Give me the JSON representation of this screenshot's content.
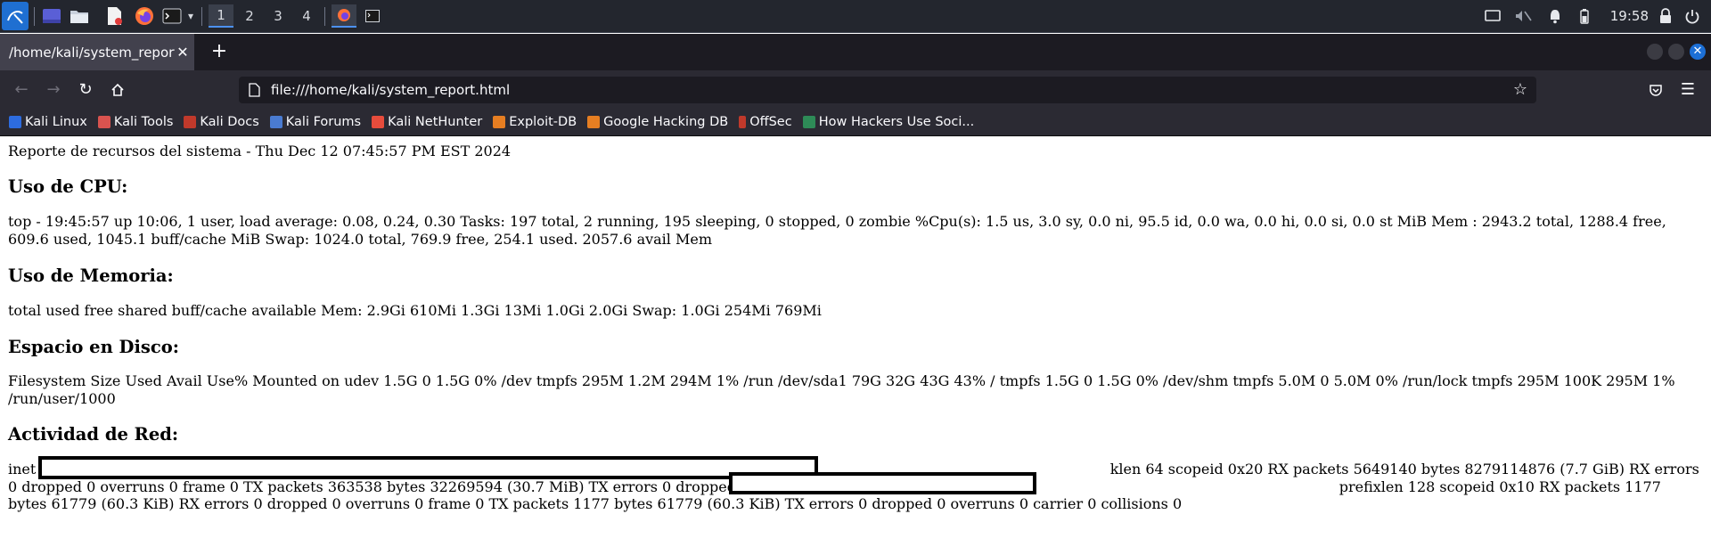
{
  "taskbar": {
    "workspaces": [
      "1",
      "2",
      "3",
      "4"
    ],
    "clock": "19:58"
  },
  "browser": {
    "tab_title": "/home/kali/system_report.html",
    "url": "file:///home/kali/system_report.html",
    "bookmarks": [
      {
        "label": "Kali Linux",
        "color": "#2d6cdf"
      },
      {
        "label": "Kali Tools",
        "color": "#d9534f"
      },
      {
        "label": "Kali Docs",
        "color": "#c0392b"
      },
      {
        "label": "Kali Forums",
        "color": "#4a7bd1"
      },
      {
        "label": "Kali NetHunter",
        "color": "#e74c3c"
      },
      {
        "label": "Exploit-DB",
        "color": "#e67e22"
      },
      {
        "label": "Google Hacking DB",
        "color": "#e67e22"
      },
      {
        "label": "OffSec",
        "color": "#c0392b"
      },
      {
        "label": "How Hackers Use Soci...",
        "color": "#2e8b57"
      }
    ]
  },
  "report": {
    "header": "Reporte de recursos del sistema - Thu Dec 12 07:45:57 PM EST 2024",
    "cpu_title": "Uso de CPU:",
    "cpu_text": "top - 19:45:57 up 10:06, 1 user, load average: 0.08, 0.24, 0.30 Tasks: 197 total, 2 running, 195 sleeping, 0 stopped, 0 zombie %Cpu(s): 1.5 us, 3.0 sy, 0.0 ni, 95.5 id, 0.0 wa, 0.0 hi, 0.0 si, 0.0 st MiB Mem : 2943.2 total, 1288.4 free, 609.6 used, 1045.1 buff/cache MiB Swap: 1024.0 total, 769.9 free, 254.1 used. 2057.6 avail Mem",
    "mem_title": "Uso de Memoria:",
    "mem_text": "total used free shared buff/cache available Mem: 2.9Gi 610Mi 1.3Gi 13Mi 1.0Gi 2.0Gi Swap: 1.0Gi 254Mi 769Mi",
    "disk_title": "Espacio en Disco:",
    "disk_text": "Filesystem Size Used Avail Use% Mounted on udev 1.5G 0 1.5G 0% /dev tmpfs 295M 1.2M 294M 1% /run /dev/sda1 79G 32G 43G 43% / tmpfs 1.5G 0 1.5G 0% /dev/shm tmpfs 5.0M 0 5.0M 0% /run/lock tmpfs 295M 100K 295M 1% /run/user/1000",
    "net_title": "Actividad de Red:",
    "net_text": "inet                                                                                                                                                                                                                                             klen 64 scopeid 0x20 RX packets 5649140 bytes 8279114876 (7.7 GiB) RX errors 0 dropped 0 overruns 0 frame 0 TX packets 363538 bytes 32269594 (30.7 MiB) TX errors 0 dropped 0 overruns 0 carrier 0 collisions 0                                                                              prefixlen 128 scopeid 0x10 RX packets 1177 bytes 61779 (60.3 KiB) RX errors 0 dropped 0 overruns 0 frame 0 TX packets 1177 bytes 61779 (60.3 KiB) TX errors 0 dropped 0 overruns 0 carrier 0 collisions 0"
  }
}
